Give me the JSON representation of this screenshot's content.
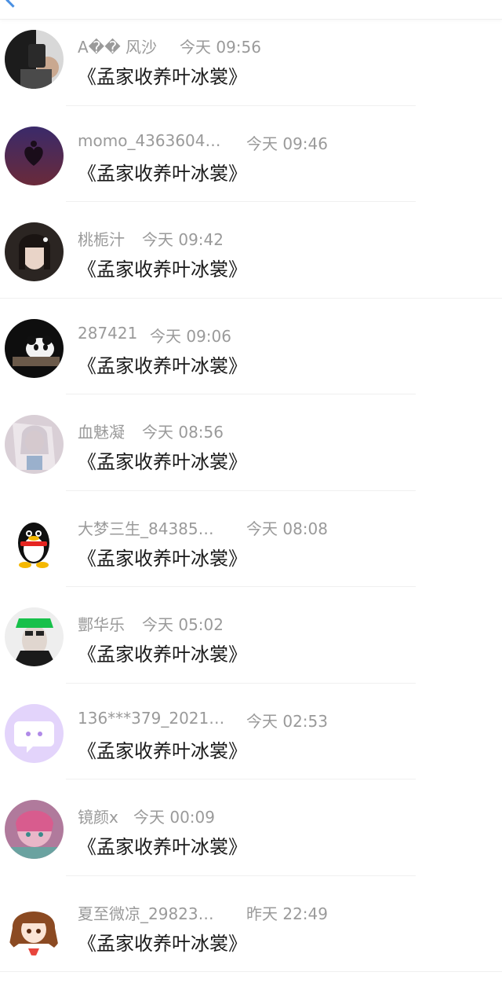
{
  "comments": [
    {
      "name": "A�� 风沙",
      "time": "今天 09:56",
      "message": "《孟家收养叶冰裳》",
      "avatar_icon": "avatar-phone-selfie"
    },
    {
      "name": "momo_4363604…",
      "time": "今天 09:46",
      "message": "《孟家收养叶冰裳》",
      "avatar_icon": "avatar-heart-silhouette"
    },
    {
      "name": "桃栀汁",
      "time": "今天 09:42",
      "message": "《孟家收养叶冰裳》",
      "avatar_icon": "avatar-girl-portrait"
    },
    {
      "name": "287421",
      "time": "今天 09:06",
      "message": "《孟家收养叶冰裳》",
      "avatar_icon": "avatar-panda"
    },
    {
      "name": "血魅凝",
      "time": "今天 08:56",
      "message": "《孟家收养叶冰裳》",
      "avatar_icon": "avatar-anime-girl"
    },
    {
      "name": "大梦三生_84385…",
      "time": "今天 08:08",
      "message": "《孟家收养叶冰裳》",
      "avatar_icon": "avatar-qq-penguin"
    },
    {
      "name": "酆华乐",
      "time": "今天 05:02",
      "message": "《孟家收养叶冰裳》",
      "avatar_icon": "avatar-man-green-hat"
    },
    {
      "name": "136***379_2021…",
      "time": "今天 02:53",
      "message": "《孟家收养叶冰裳》",
      "avatar_icon": "avatar-chat-bubble"
    },
    {
      "name": "镜颜x",
      "time": "今天 00:09",
      "message": "《孟家收养叶冰裳》",
      "avatar_icon": "avatar-pink-anime"
    },
    {
      "name": "夏至微凉_29823…",
      "time": "昨天 22:49",
      "message": "《孟家收养叶冰裳》",
      "avatar_icon": "avatar-brown-hair-anime"
    }
  ],
  "colors": {
    "accent": "#4a90e2",
    "name_text": "#9a9a9a",
    "message_text": "#1a1a1a",
    "chat_bubble_bg": "#e3d4fb"
  }
}
